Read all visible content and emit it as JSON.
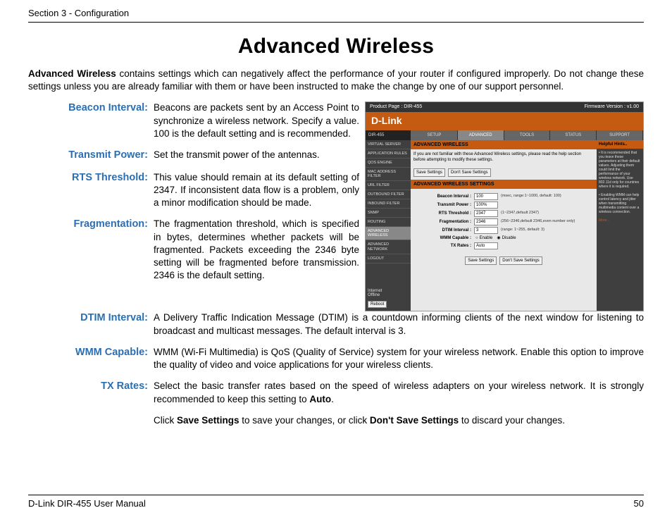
{
  "header": {
    "section": "Section 3 - Configuration"
  },
  "title": "Advanced Wireless",
  "intro_lead": "Advanced Wireless",
  "intro_rest": " contains settings which can negatively affect the performance of your router if configured improperly. Do not change these settings unless you are already familiar with them or have been instructed to make the change by one of our support personnel.",
  "defs": {
    "beacon": {
      "label": "Beacon Interval:",
      "text": "Beacons are packets sent by an Access Point to synchronize a wireless network. Specify a value. 100 is the default setting and is recommended."
    },
    "power": {
      "label": "Transmit Power:",
      "text": "Set the transmit power of the antennas."
    },
    "rts": {
      "label": "RTS Threshold:",
      "text": "This value should remain at its default setting of 2347. If inconsistent data flow is a problem, only a minor modification should be made."
    },
    "frag": {
      "label": "Fragmentation:",
      "text": "The fragmentation threshold, which is specified in bytes, determines whether packets will be fragmented. Packets exceeding the 2346 byte setting will be fragmented before transmission. 2346 is the default setting."
    },
    "dtim": {
      "label": "DTIM Interval:",
      "text": "A Delivery Traffic Indication Message (DTIM) is a countdown informing clients of the next window for listening to broadcast and multicast messages. The default interval is 3."
    },
    "wmm": {
      "label": "WMM Capable:",
      "text": "WMM (Wi-Fi Multimedia) is QoS (Quality of Service) system for your wireless network. Enable this option to improve the quality of video and voice applications for your wireless clients."
    },
    "tx": {
      "label": "TX Rates:",
      "text_pre": "Select the basic transfer rates based on the speed of wireless adapters on your wireless network. It is strongly recommended to keep this setting to ",
      "text_bold": "Auto",
      "text_post": "."
    },
    "save": {
      "pre": "Click ",
      "b1": "Save Settings",
      "mid": " to save your changes, or click ",
      "b2": "Don't Save Settings",
      "post": " to discard your changes."
    }
  },
  "shot": {
    "top_left": "Product Page : DIR-455",
    "top_right": "Firmware Version : v1.00",
    "brand": "D-Link",
    "model": "DIR-455",
    "tabs": [
      "SETUP",
      "ADVANCED",
      "TOOLS",
      "STATUS",
      "SUPPORT"
    ],
    "side": [
      "VIRTUAL SERVER",
      "APPLICATION RULES",
      "QOS ENGINE",
      "MAC ADDRESS FILTER",
      "URL FILTER",
      "OUTBOUND FILTER",
      "INBOUND FILTER",
      "SNMP",
      "ROUTING",
      "ADVANCED WIRELESS",
      "ADVANCED NETWORK",
      "LOGOUT"
    ],
    "side_footer1": "Internet",
    "side_footer2": "Offline",
    "side_reboot": "Reboot",
    "panel_title": "ADVANCED WIRELESS",
    "panel_note": "If you are not familiar with these Advanced Wireless settings, please read the help section before attempting to modify these settings.",
    "panel_title2": "ADVANCED WIRELESS SETTINGS",
    "btn_save": "Save Settings",
    "btn_dont": "Don't Save Settings",
    "form": {
      "beacon_l": "Beacon Interval :",
      "beacon_v": "100",
      "beacon_n": "(msec, range:1~1000, default: 100)",
      "power_l": "Transmit Power :",
      "power_v": "100%",
      "rts_l": "RTS Threshold :",
      "rts_v": "2347",
      "rts_n": "(1~2347,default 2347)",
      "frag_l": "Fragmentation :",
      "frag_v": "2346",
      "frag_n": "(256~2346,default 2346,even number only)",
      "dtim_l": "DTIM Interval :",
      "dtim_v": "3",
      "dtim_n": "(range: 1~255, default: 3)",
      "wmm_l": "WMM Capable :",
      "wmm_en": "Enable",
      "wmm_dis": "Disable",
      "tx_l": "TX Rates :",
      "tx_v": "Auto"
    },
    "hints_h": "Helpful Hints..",
    "hints1": "• It is recommended that you leave these parameters at their default values. Adjusting them could limit the performance of your wireless network. Use 802.11d only for countries where it is required.",
    "hints2": "• Enabling WMM can help control latency and jitter when transmitting multimedia content over a wireless connection.",
    "hints_more": "More..."
  },
  "footer": {
    "left": "D-Link DIR-455 User Manual",
    "right": "50"
  }
}
